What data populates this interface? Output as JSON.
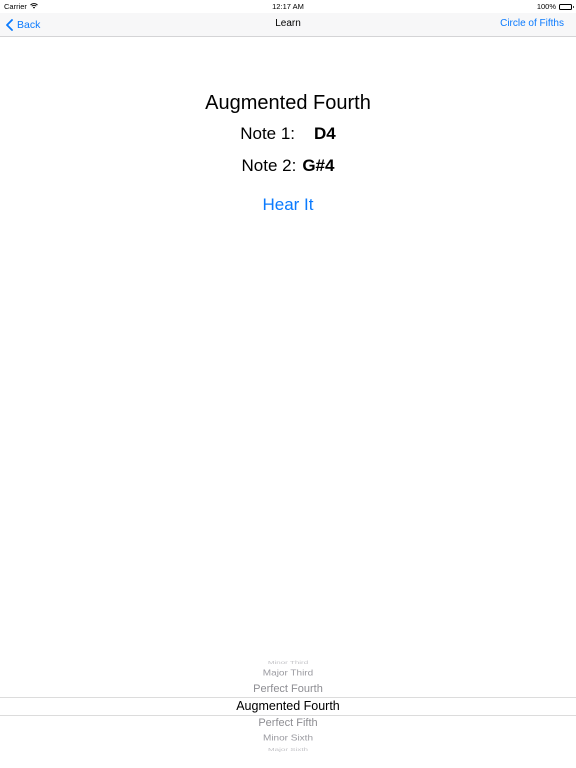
{
  "status_bar": {
    "carrier": "Carrier",
    "time": "12:17 AM",
    "battery": "100%"
  },
  "nav": {
    "back_label": "Back",
    "title": "Learn",
    "right_label": "Circle of Fifths"
  },
  "interval": {
    "name": "Augmented Fourth",
    "note1_label": "Note 1:",
    "note1_value": "D4",
    "note2_label": "Note 2:",
    "note2_value": "G#4",
    "hear_it_label": "Hear It"
  },
  "picker": {
    "items": [
      "Minor Third",
      "Major Third",
      "Perfect Fourth",
      "Augmented Fourth",
      "Perfect Fifth",
      "Minor Sixth",
      "Major Sixth"
    ],
    "selected": "Augmented Fourth"
  },
  "colors": {
    "accent": "#0a7afe",
    "nav_background": "#f7f7f8"
  }
}
